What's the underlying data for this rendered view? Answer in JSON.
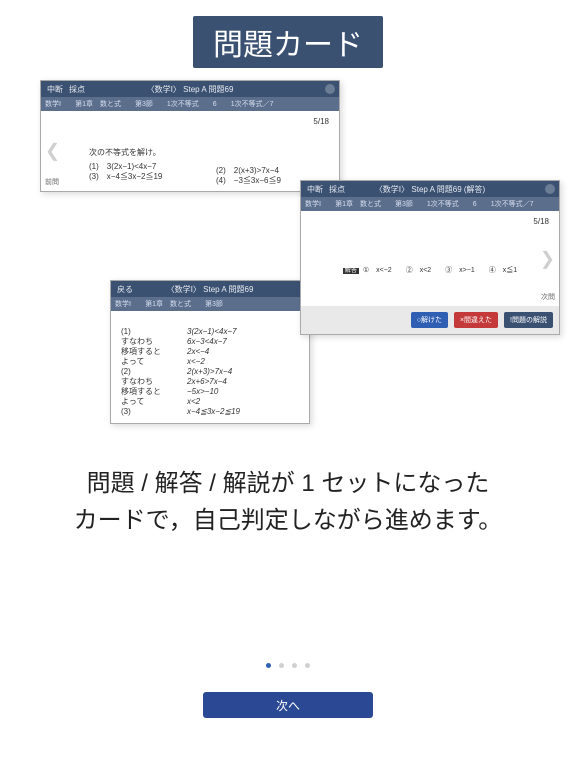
{
  "title": "問題カード",
  "caption_line1": "問題 / 解答 / 解説が 1 セットになった",
  "caption_line2": "カードで，自己判定しながら進めます。",
  "next_button": "次へ",
  "card1": {
    "menu_suspend": "中断",
    "menu_score": "採点",
    "title": "〈数学Ⅰ〉 Step A 問題69",
    "crumb_subject": "数学Ⅰ",
    "crumb_ch": "第1章　数と式",
    "crumb_sec": "第3節",
    "crumb_topic": "1次不等式",
    "crumb_num": "6",
    "crumb_type": "1次不等式／7",
    "page": "5/18",
    "prompt": "次の不等式を解け。",
    "eq1": "(1)　3(2x−1)<4x−7",
    "eq2": "(3)　x−4≦3x−2≦19",
    "eq_right1": "(2)　2(x+3)>7x−4",
    "eq_right2": "(4)　−3≦3x−6≦9",
    "nav_prev": "前問"
  },
  "card2": {
    "menu_suspend": "中断",
    "menu_score": "採点",
    "title": "〈数学Ⅰ〉 Step A 問題69 (解答)",
    "crumb_subject": "数学Ⅰ",
    "crumb_ch": "第1章　数と式",
    "crumb_sec": "第3節",
    "crumb_topic": "1次不等式",
    "crumb_num": "6",
    "crumb_type": "1次不等式／7",
    "page": "5/18",
    "ans_label": "解答",
    "ans_text": "①　x<−2　　②　x<2　　③　x>−1　　④　x≦1",
    "btn_solved": "○解けた",
    "btn_wrong": "×間違えた",
    "btn_explain": "!問題の解説",
    "nav_next": "次問"
  },
  "card3": {
    "menu_back": "戻る",
    "title": "〈数学Ⅰ〉 Step A 問題69",
    "crumb_subject": "数学Ⅰ",
    "crumb_ch": "第1章　数と式",
    "crumb_sec": "第3節",
    "work": [
      [
        "(1)",
        "3(2x−1)<4x−7"
      ],
      [
        "すなわち",
        "6x−3<4x−7"
      ],
      [
        "移項すると",
        "2x<−4"
      ],
      [
        "よって",
        "x<−2"
      ],
      [
        "(2)",
        "2(x+3)>7x−4"
      ],
      [
        "すなわち",
        "2x+6>7x−4"
      ],
      [
        "移項すると",
        "−5x>−10"
      ],
      [
        "よって",
        "x<2"
      ],
      [
        "(3)",
        "x−4≦3x−2≦19"
      ]
    ]
  }
}
